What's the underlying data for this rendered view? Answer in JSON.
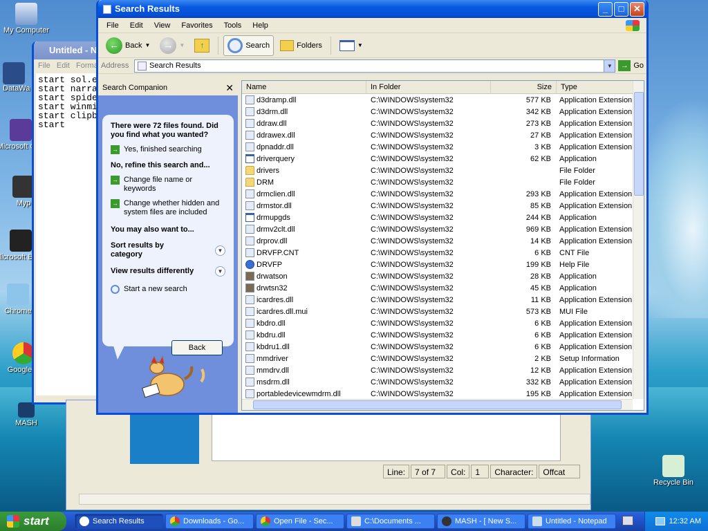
{
  "desktop": {
    "icons": [
      {
        "label": "My Computer"
      },
      {
        "label": "DataWa"
      },
      {
        "label": "Microsoft C++"
      },
      {
        "label": "Myp"
      },
      {
        "label": "Microsoft Basic"
      },
      {
        "label": "Chrome"
      },
      {
        "label": "Google C"
      },
      {
        "label": "MASH"
      },
      {
        "label": "Recycle Bin"
      }
    ]
  },
  "notepad_bg": {
    "title": "Untitled - N",
    "menu": [
      "File",
      "Edit",
      "Forma"
    ],
    "text": "start sol.e\nstart narra\nstart spide\nstart winmi\nstart clipb\nstart"
  },
  "bg_window": {
    "status": {
      "line_label": "Line:",
      "line_value": "7 of 7",
      "col_label": "Col:",
      "col_value": "1",
      "char_label": "Character:",
      "char_value": "Offcat"
    }
  },
  "window": {
    "title": "Search Results",
    "menu": [
      "File",
      "Edit",
      "View",
      "Favorites",
      "Tools",
      "Help"
    ],
    "toolbar": {
      "back": "Back",
      "search": "Search",
      "folders": "Folders"
    },
    "address": {
      "label": "Address",
      "value": "Search Results",
      "go": "Go"
    }
  },
  "search_companion": {
    "title": "Search Companion",
    "found": "There were 72 files found. Did you find what you wanted?",
    "yes": "Yes, finished searching",
    "refine": "No, refine this search and...",
    "opt1": "Change file name or keywords",
    "opt2": "Change whether hidden and system files are included",
    "also": "You may also want to...",
    "sort": "Sort results by category",
    "view": "View results differently",
    "new_search": "Start a new search",
    "back": "Back"
  },
  "list": {
    "columns": [
      "Name",
      "In Folder",
      "Size",
      "Type"
    ],
    "rows": [
      {
        "name": "d3dramp.dll",
        "folder": "C:\\WINDOWS\\system32",
        "size": "577 KB",
        "type": "Application Extension",
        "icon": "dll"
      },
      {
        "name": "d3drm.dll",
        "folder": "C:\\WINDOWS\\system32",
        "size": "342 KB",
        "type": "Application Extension",
        "icon": "dll"
      },
      {
        "name": "ddraw.dll",
        "folder": "C:\\WINDOWS\\system32",
        "size": "273 KB",
        "type": "Application Extension",
        "icon": "dll"
      },
      {
        "name": "ddrawex.dll",
        "folder": "C:\\WINDOWS\\system32",
        "size": "27 KB",
        "type": "Application Extension",
        "icon": "dll"
      },
      {
        "name": "dpnaddr.dll",
        "folder": "C:\\WINDOWS\\system32",
        "size": "3 KB",
        "type": "Application Extension",
        "icon": "dll"
      },
      {
        "name": "driverquery",
        "folder": "C:\\WINDOWS\\system32",
        "size": "62 KB",
        "type": "Application",
        "icon": "app"
      },
      {
        "name": "drivers",
        "folder": "C:\\WINDOWS\\system32",
        "size": "",
        "type": "File Folder",
        "icon": "folder"
      },
      {
        "name": "DRM",
        "folder": "C:\\WINDOWS\\system32",
        "size": "",
        "type": "File Folder",
        "icon": "folder"
      },
      {
        "name": "drmclien.dll",
        "folder": "C:\\WINDOWS\\system32",
        "size": "293 KB",
        "type": "Application Extension",
        "icon": "dll"
      },
      {
        "name": "drmstor.dll",
        "folder": "C:\\WINDOWS\\system32",
        "size": "85 KB",
        "type": "Application Extension",
        "icon": "dll"
      },
      {
        "name": "drmupgds",
        "folder": "C:\\WINDOWS\\system32",
        "size": "244 KB",
        "type": "Application",
        "icon": "app"
      },
      {
        "name": "drmv2clt.dll",
        "folder": "C:\\WINDOWS\\system32",
        "size": "969 KB",
        "type": "Application Extension",
        "icon": "dll"
      },
      {
        "name": "drprov.dll",
        "folder": "C:\\WINDOWS\\system32",
        "size": "14 KB",
        "type": "Application Extension",
        "icon": "dll"
      },
      {
        "name": "DRVFP.CNT",
        "folder": "C:\\WINDOWS\\system32",
        "size": "6 KB",
        "type": "CNT File",
        "icon": "dll"
      },
      {
        "name": "DRVFP",
        "folder": "C:\\WINDOWS\\system32",
        "size": "199 KB",
        "type": "Help File",
        "icon": "help"
      },
      {
        "name": "drwatson",
        "folder": "C:\\WINDOWS\\system32",
        "size": "28 KB",
        "type": "Application",
        "icon": "img"
      },
      {
        "name": "drwtsn32",
        "folder": "C:\\WINDOWS\\system32",
        "size": "45 KB",
        "type": "Application",
        "icon": "img"
      },
      {
        "name": "icardres.dll",
        "folder": "C:\\WINDOWS\\system32",
        "size": "11 KB",
        "type": "Application Extension",
        "icon": "dll"
      },
      {
        "name": "icardres.dll.mui",
        "folder": "C:\\WINDOWS\\system32",
        "size": "573 KB",
        "type": "MUI File",
        "icon": "dll"
      },
      {
        "name": "kbdro.dll",
        "folder": "C:\\WINDOWS\\system32",
        "size": "6 KB",
        "type": "Application Extension",
        "icon": "dll"
      },
      {
        "name": "kbdru.dll",
        "folder": "C:\\WINDOWS\\system32",
        "size": "6 KB",
        "type": "Application Extension",
        "icon": "dll"
      },
      {
        "name": "kbdru1.dll",
        "folder": "C:\\WINDOWS\\system32",
        "size": "6 KB",
        "type": "Application Extension",
        "icon": "dll"
      },
      {
        "name": "mmdriver",
        "folder": "C:\\WINDOWS\\system32",
        "size": "2 KB",
        "type": "Setup Information",
        "icon": "dll"
      },
      {
        "name": "mmdrv.dll",
        "folder": "C:\\WINDOWS\\system32",
        "size": "12 KB",
        "type": "Application Extension",
        "icon": "dll"
      },
      {
        "name": "msdrm.dll",
        "folder": "C:\\WINDOWS\\system32",
        "size": "332 KB",
        "type": "Application Extension",
        "icon": "dll"
      },
      {
        "name": "portabledevicewmdrm.dll",
        "folder": "C:\\WINDOWS\\system32",
        "size": "195 KB",
        "type": "Application Extension",
        "icon": "dll"
      }
    ]
  },
  "taskbar": {
    "start": "start",
    "tasks": [
      "Search Results",
      "Downloads - Go...",
      "Open File - Sec...",
      "C:\\Documents ...",
      "MASH - [ New S...",
      "Untitled - Notepad"
    ],
    "clock": "12:32 AM"
  }
}
